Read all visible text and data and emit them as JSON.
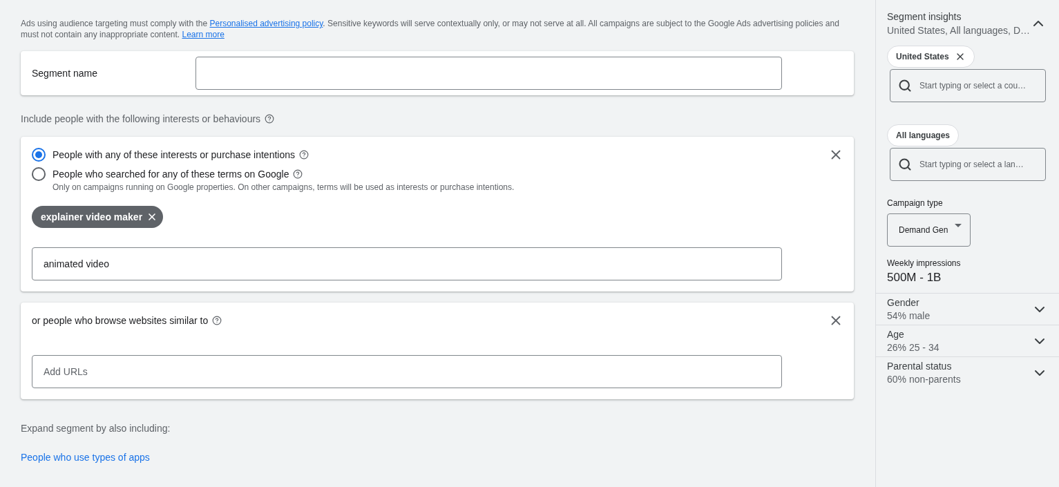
{
  "notice": {
    "before": "Ads using audience targeting must comply with the ",
    "policy_link": "Personalised advertising policy",
    "middle": ". Sensitive keywords will serve contextually only, or may not serve at all. All campaigns are subject to the Google Ads advertising policies and must not contain any inappropriate content. ",
    "learn_more": "Learn more"
  },
  "segment_name": {
    "label": "Segment name"
  },
  "include_label": "Include people with the following interests or behaviours",
  "interests_card": {
    "options": [
      {
        "label": "People with any of these interests or purchase intentions",
        "selected": true
      },
      {
        "label": "People who searched for any of these terms on Google",
        "selected": false,
        "hint": "Only on campaigns running on Google properties. On other campaigns, terms will be used as interests or purchase intentions."
      }
    ],
    "chips": [
      "explainer video maker"
    ],
    "input_value": "animated video"
  },
  "websites_card": {
    "label": "or people who browse websites similar to",
    "placeholder": "Add URLs"
  },
  "expand_label": "Expand segment by also including:",
  "apps_link": "People who use types of apps",
  "sidebar": {
    "title": "Segment insights",
    "summary": "United States, All languages, D…",
    "expanded": true,
    "location_chips": [
      {
        "label": "United States",
        "removable": true
      }
    ],
    "location_placeholder": "Start typing or select a cou…",
    "language_chips": [
      {
        "label": "All languages",
        "removable": false
      }
    ],
    "language_placeholder": "Start typing or select a lan…",
    "campaign_type_label": "Campaign type",
    "campaign_type": "Demand Gen",
    "impressions_label": "Weekly impressions",
    "impressions": "500M - 1B",
    "sections": [
      {
        "title": "Gender",
        "value": "54% male",
        "expanded": false
      },
      {
        "title": "Age",
        "value": "26% 25 - 34",
        "expanded": false
      },
      {
        "title": "Parental status",
        "value": "60% non-parents",
        "expanded": false
      }
    ]
  }
}
